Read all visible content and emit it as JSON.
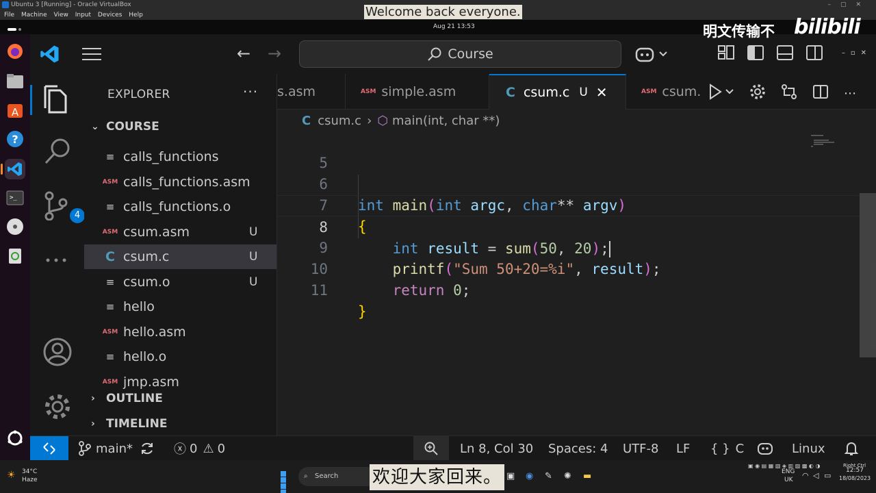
{
  "vbox": {
    "title": "Ubuntu 3 [Running] - Oracle VirtualBox",
    "menu": [
      "File",
      "Machine",
      "View",
      "Input",
      "Devices",
      "Help"
    ]
  },
  "ubuntu": {
    "clock": "Aug 21  13:53"
  },
  "overlay": {
    "subtitle_en": "Welcome back everyone.",
    "subtitle_zh": "欢迎大家回来。",
    "watermark": "明文传输不",
    "bilibili": "bilibili"
  },
  "titlebar": {
    "search": "Course"
  },
  "activity": {
    "scm_badge": "4"
  },
  "sidebar": {
    "title": "EXPLORER",
    "folder": "COURSE",
    "files": [
      {
        "name": "calls_functions",
        "type": "lines",
        "status": ""
      },
      {
        "name": "calls_functions.asm",
        "type": "asm",
        "status": ""
      },
      {
        "name": "calls_functions.o",
        "type": "lines",
        "status": ""
      },
      {
        "name": "csum.asm",
        "type": "asm",
        "status": "U"
      },
      {
        "name": "csum.c",
        "type": "c",
        "status": "U"
      },
      {
        "name": "csum.o",
        "type": "lines",
        "status": "U"
      },
      {
        "name": "hello",
        "type": "lines",
        "status": ""
      },
      {
        "name": "hello.asm",
        "type": "asm",
        "status": ""
      },
      {
        "name": "hello.o",
        "type": "lines",
        "status": ""
      },
      {
        "name": "jmp.asm",
        "type": "asm",
        "status": ""
      }
    ],
    "outline": "OUTLINE",
    "timeline": "TIMELINE"
  },
  "tabs": [
    {
      "label": "s.asm",
      "icon": "asm"
    },
    {
      "label": "simple.asm",
      "icon": "asm"
    },
    {
      "label": "csum.c",
      "icon": "c",
      "modified": "U",
      "active": true
    },
    {
      "label": "csum.",
      "icon": "asm"
    }
  ],
  "icon_labels": {
    "asm": "ASM",
    "c": "C",
    "lines": "≡",
    "close": "✕"
  },
  "breadcrumb": {
    "file": "csum.c",
    "symbol": "main(int, char **)"
  },
  "editor": {
    "line_numbers": [
      "5",
      "6",
      "7",
      "8",
      "9",
      "10",
      "11"
    ],
    "current_line": "8"
  },
  "statusbar": {
    "branch": "main*",
    "errors": "0",
    "warnings": "0",
    "position": "Ln 8, Col 30",
    "spaces": "Spaces: 4",
    "encoding": "UTF-8",
    "eol": "LF",
    "language": "C",
    "os": "Linux"
  },
  "taskbar": {
    "temp": "34°C",
    "weather": "Haze",
    "search": "Search",
    "lang": "ENG",
    "region": "UK",
    "time": "12:57",
    "date": "18/08/2023",
    "vbox_key": "Right Ctrl"
  },
  "colors": {
    "accent": "#0078d4",
    "asm_icon": "#e06c75",
    "c_icon": "#519aba"
  }
}
